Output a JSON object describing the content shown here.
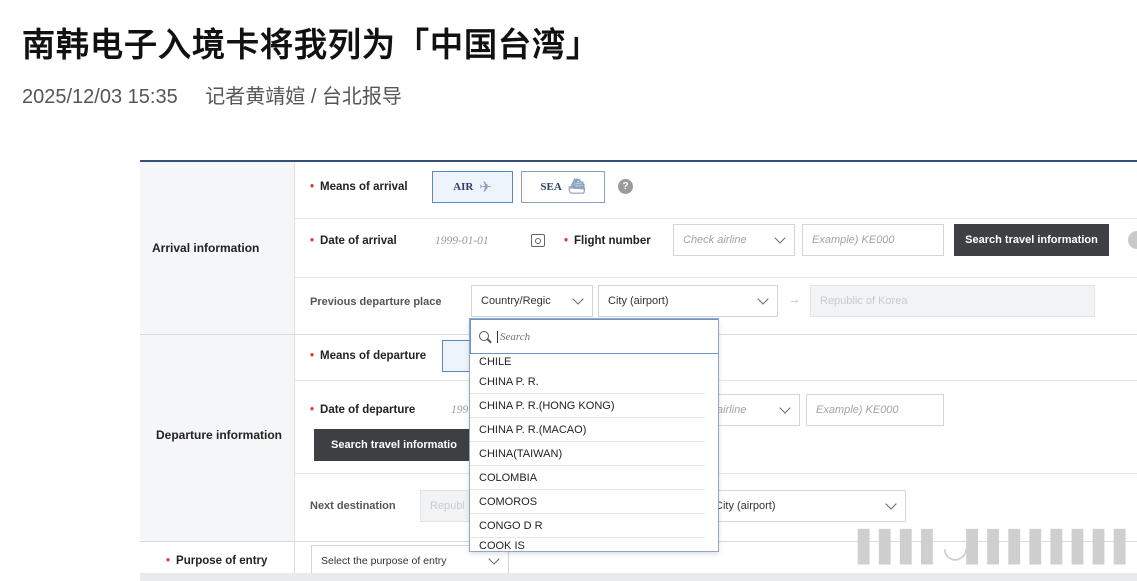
{
  "article": {
    "headline": "南韩电子入境卡将我列为「中国台湾」",
    "date": "2025/12/03 15:35",
    "byline": "记者黄靖媗 / 台北报导"
  },
  "form": {
    "arrival": {
      "section_label": "Arrival information",
      "means_label": "Means of arrival",
      "air_label": "AIR",
      "sea_label": "SEA",
      "help": "?",
      "date_label": "Date of arrival",
      "date_value": "1999-01-01",
      "flight_label": "Flight number",
      "airline_placeholder": "Check airline",
      "flight_placeholder": "Example) KE000",
      "search_button": "Search travel information",
      "prev_place_label": "Previous departure place",
      "country_select": "Country/Regic",
      "city_select": "City (airport)",
      "destination_value": "Republic of Korea"
    },
    "departure": {
      "section_label": "Departure information",
      "means_label": "Means of departure",
      "date_label": "Date of departure",
      "date_value_partial": "199",
      "airline_partial": "airline",
      "flight_placeholder": "Example) KE000",
      "search_button_partial": "Search travel informatio",
      "next_dest_label": "Next destination",
      "next_dest_partial": "Republ",
      "city_partial": "City (airport)"
    },
    "purpose": {
      "label": "Purpose of entry",
      "select_value": "Select the purpose of entry"
    }
  },
  "dropdown": {
    "search_placeholder": "Search",
    "options": [
      "CHILE",
      "CHINA P. R.",
      "CHINA P. R.(HONG KONG)",
      "CHINA P. R.(MACAO)",
      "CHINA(TAIWAN)",
      "COLOMBIA",
      "COMOROS",
      "CONGO D R",
      "COOK IS"
    ]
  },
  "colors": {
    "accent_line": "#34507a",
    "required": "#d9383a",
    "dark_button": "#3e4043"
  },
  "icons": {
    "air": "airplane-icon",
    "sea": "ship-icon",
    "calendar": "calendar-icon",
    "search": "magnifier-icon",
    "chevron": "chevron-down-icon"
  }
}
